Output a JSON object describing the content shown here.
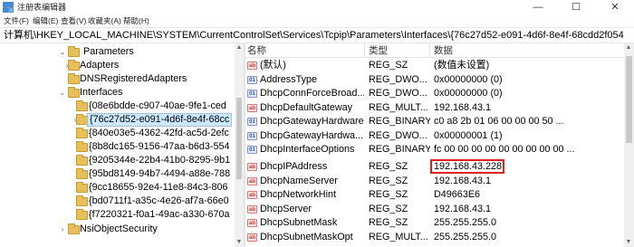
{
  "window": {
    "title": "注册表编辑器",
    "minimize": "—",
    "maximize": "☐",
    "close": "✕"
  },
  "menu": [
    "文件(F)",
    "编辑(E)",
    "查看(V)",
    "收藏夹(A)",
    "帮助(H)"
  ],
  "address": "计算机\\HKEY_LOCAL_MACHINE\\SYSTEM\\CurrentControlSet\\Services\\Tcpip\\Parameters\\Interfaces\\{76c27d52-e091-4d6f-8e4f-68cdd2f054",
  "tree": [
    {
      "label": "Parameters",
      "expanded": true
    },
    {
      "label": "Adapters",
      "expanded": false
    },
    {
      "label": "DNSRegisteredAdapters",
      "expanded": false
    },
    {
      "label": "Interfaces",
      "expanded": true
    },
    {
      "label": "{08e6bdde-c907-40ae-9fe1-ced",
      "expanded": false
    },
    {
      "label": "{76c27d52-e091-4d6f-8e4f-68cc",
      "expanded": false,
      "selected": true
    },
    {
      "label": "{840e03e5-4362-42fd-ac5d-2efc",
      "expanded": false
    },
    {
      "label": "{8b8dc165-9156-47aa-b6d3-554",
      "expanded": false
    },
    {
      "label": "{9205344e-22b4-41b0-8295-9b1",
      "expanded": false
    },
    {
      "label": "{95bd8149-94b7-4494-a88e-788",
      "expanded": false
    },
    {
      "label": "{9cc18655-92e4-11e8-84c3-806",
      "expanded": false
    },
    {
      "label": "{bd0711f1-a35c-4e26-af7a-66e0",
      "expanded": false
    },
    {
      "label": "{f7220321-f0a1-49ac-a330-670a",
      "expanded": false
    },
    {
      "label": "NsiObjectSecurity",
      "expanded": false
    }
  ],
  "columns": {
    "name": "名称",
    "type": "类型",
    "data": "数据"
  },
  "values": [
    {
      "name": "(默认)",
      "type": "REG_SZ",
      "data": "(数值未设置)",
      "icon": "sz"
    },
    {
      "name": "AddressType",
      "type": "REG_DWO...",
      "data": "0x00000000 (0)",
      "icon": "bin"
    },
    {
      "name": "DhcpConnForceBroad...",
      "type": "REG_DWO...",
      "data": "0x00000000 (0)",
      "icon": "bin"
    },
    {
      "name": "DhcpDefaultGateway",
      "type": "REG_MULT...",
      "data": "192.168.43.1",
      "icon": "sz"
    },
    {
      "name": "DhcpGatewayHardware",
      "type": "REG_BINARY",
      "data": "c0 a8 2b 01 06 00 00 00 50 ...",
      "icon": "bin"
    },
    {
      "name": "DhcpGatewayHardwa...",
      "type": "REG_DWO...",
      "data": "0x00000001 (1)",
      "icon": "bin"
    },
    {
      "name": "DhcpInterfaceOptions",
      "type": "REG_BINARY",
      "data": "fc 00 00 00 00 00 00 00 00 00 ...",
      "icon": "bin"
    },
    {
      "name": "DhcpIPAddress",
      "type": "REG_SZ",
      "data": "192.168.43.228",
      "icon": "sz",
      "highlighted": true
    },
    {
      "name": "DhcpNameServer",
      "type": "REG_SZ",
      "data": "192.168.43.1",
      "icon": "sz"
    },
    {
      "name": "DhcpNetworkHint",
      "type": "REG_SZ",
      "data": "D49663E6",
      "icon": "sz"
    },
    {
      "name": "DhcpServer",
      "type": "REG_SZ",
      "data": "192.168.43.1",
      "icon": "sz"
    },
    {
      "name": "DhcpSubnetMask",
      "type": "REG_SZ",
      "data": "255.255.255.0",
      "icon": "sz"
    },
    {
      "name": "DhcpSubnetMaskOpt",
      "type": "REG_MULT...",
      "data": "255.255.255.0",
      "icon": "sz"
    }
  ],
  "icons": {
    "expanded": "⌄",
    "collapsed": "›",
    "string_value": "ab",
    "binary_value": "01"
  },
  "colors": {
    "highlight_border": "#e02020",
    "selection": "#cce8ff",
    "folder": "#e8c05a"
  }
}
